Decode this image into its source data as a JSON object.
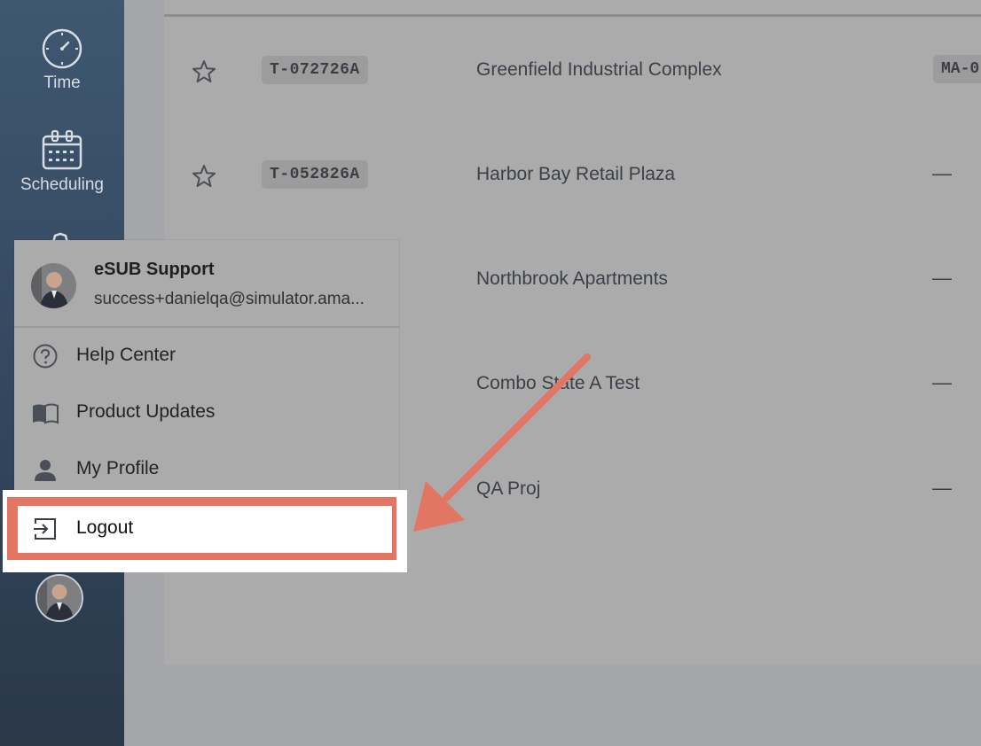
{
  "sidebar": {
    "items": [
      {
        "label": "Time",
        "icon": "clock-icon"
      },
      {
        "label": "Scheduling",
        "icon": "calendar-icon"
      }
    ]
  },
  "projects": [
    {
      "code": "T-072726A",
      "name": "Greenfield Industrial Complex",
      "extra": "MA-0"
    },
    {
      "code": "T-052826A",
      "name": "Harbor Bay Retail Plaza",
      "extra": "—"
    },
    {
      "code": "",
      "name": "Northbrook Apartments",
      "extra": "—"
    },
    {
      "code": "",
      "name": "Combo State A Test",
      "extra": "—"
    },
    {
      "code": "",
      "name": "QA Proj",
      "extra": "—"
    }
  ],
  "user_menu": {
    "user_name": "eSUB Support",
    "user_email": "success+danielqa@simulator.ama...",
    "items": [
      {
        "label": "Help Center",
        "icon": "help-circle-icon"
      },
      {
        "label": "Product Updates",
        "icon": "book-icon"
      },
      {
        "label": "My Profile",
        "icon": "person-icon"
      }
    ],
    "logout_label": "Logout"
  },
  "colors": {
    "sidebar": "#3f5771",
    "highlight": "#e27663",
    "overlay": "#ababab"
  }
}
